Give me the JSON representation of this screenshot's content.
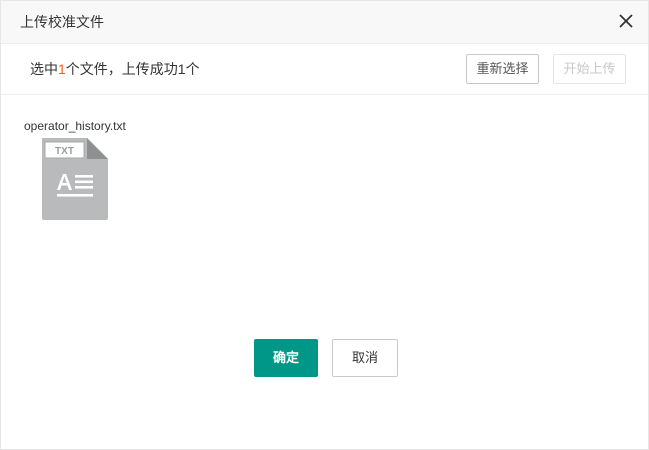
{
  "dialog": {
    "title": "上传校准文件",
    "close_icon": "close-icon"
  },
  "toolbar": {
    "summary": {
      "prefix": "选中",
      "selected_count": "1",
      "middle": "个文件，上传成功",
      "success_count": "1",
      "suffix": "个"
    },
    "reselect_label": "重新选择",
    "start_upload_label": "开始上传",
    "start_upload_disabled": true
  },
  "files": [
    {
      "name": "operator_history.txt",
      "type_badge": "TXT",
      "icon": "txt-file-icon"
    }
  ],
  "footer": {
    "confirm_label": "确定",
    "cancel_label": "取消"
  },
  "colors": {
    "accent": "#009688",
    "highlight": "#ff5722",
    "file_icon": "#b8babc"
  }
}
